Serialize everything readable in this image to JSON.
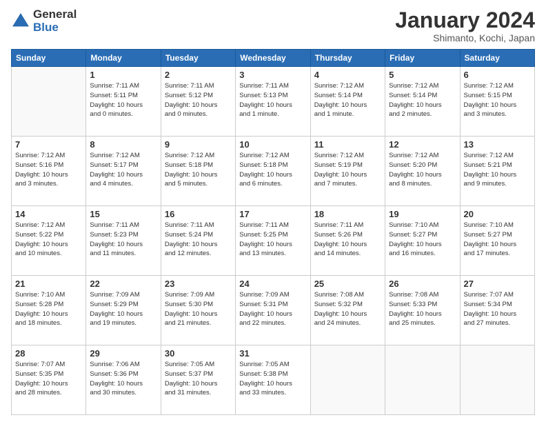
{
  "logo": {
    "line1": "General",
    "line2": "Blue"
  },
  "title": "January 2024",
  "subtitle": "Shimanto, Kochi, Japan",
  "headers": [
    "Sunday",
    "Monday",
    "Tuesday",
    "Wednesday",
    "Thursday",
    "Friday",
    "Saturday"
  ],
  "weeks": [
    [
      {
        "day": "",
        "info": ""
      },
      {
        "day": "1",
        "info": "Sunrise: 7:11 AM\nSunset: 5:11 PM\nDaylight: 10 hours\nand 0 minutes."
      },
      {
        "day": "2",
        "info": "Sunrise: 7:11 AM\nSunset: 5:12 PM\nDaylight: 10 hours\nand 0 minutes."
      },
      {
        "day": "3",
        "info": "Sunrise: 7:11 AM\nSunset: 5:13 PM\nDaylight: 10 hours\nand 1 minute."
      },
      {
        "day": "4",
        "info": "Sunrise: 7:12 AM\nSunset: 5:14 PM\nDaylight: 10 hours\nand 1 minute."
      },
      {
        "day": "5",
        "info": "Sunrise: 7:12 AM\nSunset: 5:14 PM\nDaylight: 10 hours\nand 2 minutes."
      },
      {
        "day": "6",
        "info": "Sunrise: 7:12 AM\nSunset: 5:15 PM\nDaylight: 10 hours\nand 3 minutes."
      }
    ],
    [
      {
        "day": "7",
        "info": "Sunrise: 7:12 AM\nSunset: 5:16 PM\nDaylight: 10 hours\nand 3 minutes."
      },
      {
        "day": "8",
        "info": "Sunrise: 7:12 AM\nSunset: 5:17 PM\nDaylight: 10 hours\nand 4 minutes."
      },
      {
        "day": "9",
        "info": "Sunrise: 7:12 AM\nSunset: 5:18 PM\nDaylight: 10 hours\nand 5 minutes."
      },
      {
        "day": "10",
        "info": "Sunrise: 7:12 AM\nSunset: 5:18 PM\nDaylight: 10 hours\nand 6 minutes."
      },
      {
        "day": "11",
        "info": "Sunrise: 7:12 AM\nSunset: 5:19 PM\nDaylight: 10 hours\nand 7 minutes."
      },
      {
        "day": "12",
        "info": "Sunrise: 7:12 AM\nSunset: 5:20 PM\nDaylight: 10 hours\nand 8 minutes."
      },
      {
        "day": "13",
        "info": "Sunrise: 7:12 AM\nSunset: 5:21 PM\nDaylight: 10 hours\nand 9 minutes."
      }
    ],
    [
      {
        "day": "14",
        "info": "Sunrise: 7:12 AM\nSunset: 5:22 PM\nDaylight: 10 hours\nand 10 minutes."
      },
      {
        "day": "15",
        "info": "Sunrise: 7:11 AM\nSunset: 5:23 PM\nDaylight: 10 hours\nand 11 minutes."
      },
      {
        "day": "16",
        "info": "Sunrise: 7:11 AM\nSunset: 5:24 PM\nDaylight: 10 hours\nand 12 minutes."
      },
      {
        "day": "17",
        "info": "Sunrise: 7:11 AM\nSunset: 5:25 PM\nDaylight: 10 hours\nand 13 minutes."
      },
      {
        "day": "18",
        "info": "Sunrise: 7:11 AM\nSunset: 5:26 PM\nDaylight: 10 hours\nand 14 minutes."
      },
      {
        "day": "19",
        "info": "Sunrise: 7:10 AM\nSunset: 5:27 PM\nDaylight: 10 hours\nand 16 minutes."
      },
      {
        "day": "20",
        "info": "Sunrise: 7:10 AM\nSunset: 5:27 PM\nDaylight: 10 hours\nand 17 minutes."
      }
    ],
    [
      {
        "day": "21",
        "info": "Sunrise: 7:10 AM\nSunset: 5:28 PM\nDaylight: 10 hours\nand 18 minutes."
      },
      {
        "day": "22",
        "info": "Sunrise: 7:09 AM\nSunset: 5:29 PM\nDaylight: 10 hours\nand 19 minutes."
      },
      {
        "day": "23",
        "info": "Sunrise: 7:09 AM\nSunset: 5:30 PM\nDaylight: 10 hours\nand 21 minutes."
      },
      {
        "day": "24",
        "info": "Sunrise: 7:09 AM\nSunset: 5:31 PM\nDaylight: 10 hours\nand 22 minutes."
      },
      {
        "day": "25",
        "info": "Sunrise: 7:08 AM\nSunset: 5:32 PM\nDaylight: 10 hours\nand 24 minutes."
      },
      {
        "day": "26",
        "info": "Sunrise: 7:08 AM\nSunset: 5:33 PM\nDaylight: 10 hours\nand 25 minutes."
      },
      {
        "day": "27",
        "info": "Sunrise: 7:07 AM\nSunset: 5:34 PM\nDaylight: 10 hours\nand 27 minutes."
      }
    ],
    [
      {
        "day": "28",
        "info": "Sunrise: 7:07 AM\nSunset: 5:35 PM\nDaylight: 10 hours\nand 28 minutes."
      },
      {
        "day": "29",
        "info": "Sunrise: 7:06 AM\nSunset: 5:36 PM\nDaylight: 10 hours\nand 30 minutes."
      },
      {
        "day": "30",
        "info": "Sunrise: 7:05 AM\nSunset: 5:37 PM\nDaylight: 10 hours\nand 31 minutes."
      },
      {
        "day": "31",
        "info": "Sunrise: 7:05 AM\nSunset: 5:38 PM\nDaylight: 10 hours\nand 33 minutes."
      },
      {
        "day": "",
        "info": ""
      },
      {
        "day": "",
        "info": ""
      },
      {
        "day": "",
        "info": ""
      }
    ]
  ]
}
